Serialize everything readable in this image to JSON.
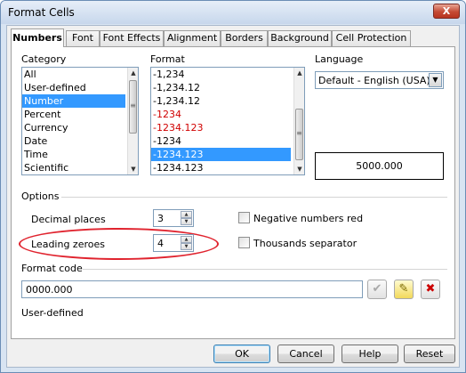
{
  "window": {
    "title": "Format Cells",
    "close_label": "X"
  },
  "tabs": [
    {
      "label": "Numbers",
      "active": true
    },
    {
      "label": "Font"
    },
    {
      "label": "Font Effects"
    },
    {
      "label": "Alignment"
    },
    {
      "label": "Borders"
    },
    {
      "label": "Background"
    },
    {
      "label": "Cell Protection"
    }
  ],
  "category": {
    "label": "Category",
    "items": [
      "All",
      "User-defined",
      "Number",
      "Percent",
      "Currency",
      "Date",
      "Time",
      "Scientific"
    ],
    "selected": "Number"
  },
  "format": {
    "label": "Format",
    "items": [
      "-1,234",
      "-1,234.12",
      "-1,234.12",
      "-1234",
      "-1234.123",
      "-1234",
      "-1234.123",
      "-1234.123"
    ],
    "red_items": [
      3,
      4
    ],
    "selected_index": 6
  },
  "language": {
    "label": "Language",
    "value": "Default - English (USA)"
  },
  "preview": {
    "value": "5000.000"
  },
  "options": {
    "label": "Options",
    "decimal_places": {
      "label": "Decimal places",
      "value": "3"
    },
    "leading_zeroes": {
      "label": "Leading zeroes",
      "value": "4"
    },
    "negative_red": {
      "label": "Negative numbers red",
      "checked": false
    },
    "thousands_separator": {
      "label": "Thousands separator",
      "checked": false
    }
  },
  "format_code": {
    "label": "Format code",
    "value": "0000.000",
    "description": "User-defined"
  },
  "buttons": {
    "ok": "OK",
    "cancel": "Cancel",
    "help": "Help",
    "reset": "Reset"
  },
  "colors": {
    "highlight": "#e0232e",
    "selection": "#3399ff",
    "negative_red": "#d00000"
  }
}
